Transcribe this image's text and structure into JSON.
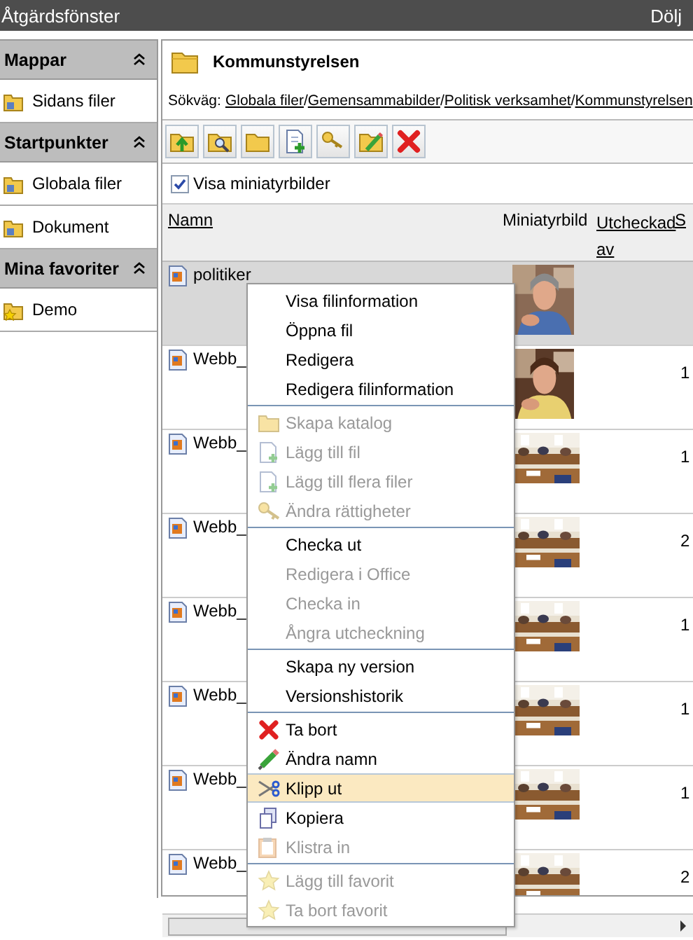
{
  "window": {
    "title": "Åtgärdsfönster",
    "hide_link": "Dölj"
  },
  "sidebar": [
    {
      "title": "Mappar",
      "expanded": true,
      "items": [
        {
          "label": "Sidans filer",
          "kind": "folder"
        }
      ]
    },
    {
      "title": "Startpunkter",
      "expanded": true,
      "items": [
        {
          "label": "Globala filer",
          "kind": "folder"
        },
        {
          "label": "Dokument",
          "kind": "folder"
        }
      ]
    },
    {
      "title": "Mina favoriter",
      "expanded": true,
      "items": [
        {
          "label": "Demo",
          "kind": "favorite"
        }
      ]
    }
  ],
  "folder": {
    "title": "Kommunstyrelsen",
    "path_label": "Sökväg:",
    "path": [
      {
        "text": "Globala filer",
        "kind": "link"
      },
      {
        "text": "/",
        "kind": "separator"
      },
      {
        "text": "Gemensammabilder",
        "kind": "link"
      },
      {
        "text": "/",
        "kind": "separator"
      },
      {
        "text": "Politisk verksamhet",
        "kind": "link"
      },
      {
        "text": "/",
        "kind": "separator"
      },
      {
        "text": "Kommunstyrelsen",
        "kind": "link"
      }
    ]
  },
  "show_thumbnails": {
    "label": "Visa miniatyrbilder",
    "checked": true
  },
  "table": {
    "columns": [
      "Namn",
      "Miniatyrbild",
      "Utcheckad av",
      "S"
    ],
    "rows": [
      {
        "name": "politiker",
        "column_4": "",
        "selected": true
      },
      {
        "name": "Webb_",
        "column_4": "1",
        "selected": false
      },
      {
        "name": "Webb_",
        "column_4": "1",
        "selected": false
      },
      {
        "name": "Webb_",
        "column_4": "2",
        "selected": false
      },
      {
        "name": "Webb_",
        "column_4": "1",
        "selected": false
      },
      {
        "name": "Webb_",
        "column_4": "1",
        "selected": false
      },
      {
        "name": "Webb_",
        "column_4": "1",
        "selected": false
      },
      {
        "name": "Webb_",
        "column_4": "2",
        "selected": false
      }
    ]
  },
  "context_menu": [
    [
      {
        "label": "Visa filinformation",
        "kind": "plain",
        "disabled": false,
        "selected": false
      },
      {
        "label": "Öppna fil",
        "kind": "plain",
        "disabled": false,
        "selected": false
      },
      {
        "label": "Redigera",
        "kind": "plain",
        "disabled": false,
        "selected": false
      },
      {
        "label": "Redigera filinformation",
        "kind": "plain",
        "disabled": false,
        "selected": false
      }
    ],
    [
      {
        "label": "Skapa katalog",
        "kind": "folder",
        "disabled": true,
        "selected": false
      },
      {
        "label": "Lägg till fil",
        "kind": "file-add",
        "disabled": true,
        "selected": false
      },
      {
        "label": "Lägg till flera filer",
        "kind": "file-add",
        "disabled": true,
        "selected": false
      },
      {
        "label": "Ändra rättigheter",
        "kind": "key",
        "disabled": true,
        "selected": false
      }
    ],
    [
      {
        "label": "Checka ut",
        "kind": "plain",
        "disabled": false,
        "selected": false
      },
      {
        "label": "Redigera i Office",
        "kind": "plain",
        "disabled": true,
        "selected": false
      },
      {
        "label": "Checka in",
        "kind": "plain",
        "disabled": true,
        "selected": false
      },
      {
        "label": "Ångra utcheckning",
        "kind": "plain",
        "disabled": true,
        "selected": false
      }
    ],
    [
      {
        "label": "Skapa ny version",
        "kind": "plain",
        "disabled": false,
        "selected": false
      },
      {
        "label": "Versionshistorik",
        "kind": "plain",
        "disabled": false,
        "selected": false
      }
    ],
    [
      {
        "label": "Ta bort",
        "kind": "delete",
        "disabled": false,
        "selected": false
      },
      {
        "label": "Ändra namn",
        "kind": "pencil",
        "disabled": false,
        "selected": false
      },
      {
        "label": "Klipp ut",
        "kind": "scissors",
        "disabled": false,
        "selected": true
      },
      {
        "label": "Kopiera",
        "kind": "copy",
        "disabled": false,
        "selected": false
      },
      {
        "label": "Klistra in",
        "kind": "paste",
        "disabled": true,
        "selected": false
      }
    ],
    [
      {
        "label": "Lägg till favorit",
        "kind": "star",
        "disabled": true,
        "selected": false
      },
      {
        "label": "Ta bort favorit",
        "kind": "star",
        "disabled": true,
        "selected": false
      }
    ]
  ]
}
